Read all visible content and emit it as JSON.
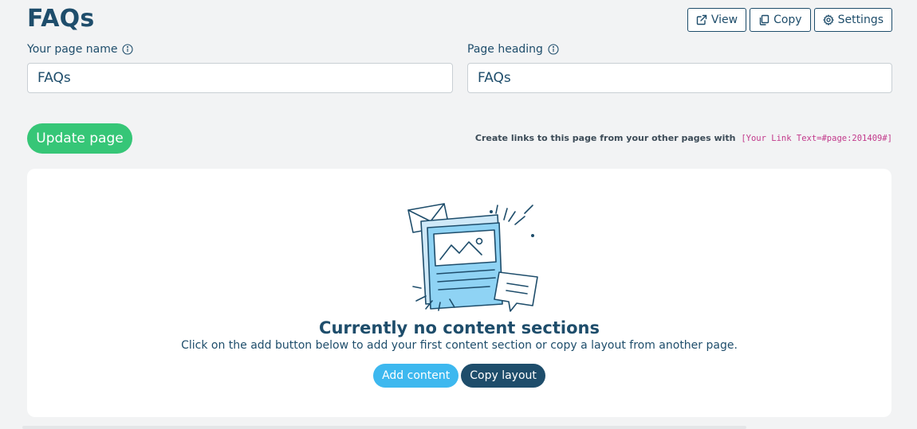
{
  "header": {
    "title": "FAQs",
    "actions": {
      "view_label": "View",
      "copy_label": "Copy",
      "settings_label": "Settings"
    }
  },
  "form": {
    "page_name": {
      "label": "Your page name",
      "value": "FAQs"
    },
    "page_heading": {
      "label": "Page heading",
      "value": "FAQs"
    },
    "update_label": "Update page",
    "link_hint": {
      "text": "Create links to this page from your other pages with",
      "code": "[Your Link Text=#page:201409#]"
    }
  },
  "empty_state": {
    "title": "Currently no content sections",
    "subtitle": "Click on the add button below to add your first content section or copy a layout from another page.",
    "add_label": "Add content",
    "copy_layout_label": "Copy layout"
  },
  "colors": {
    "primary": "#1e4d6b",
    "success": "#36c677",
    "accent": "#3db8ef",
    "code": "#c2398b"
  }
}
